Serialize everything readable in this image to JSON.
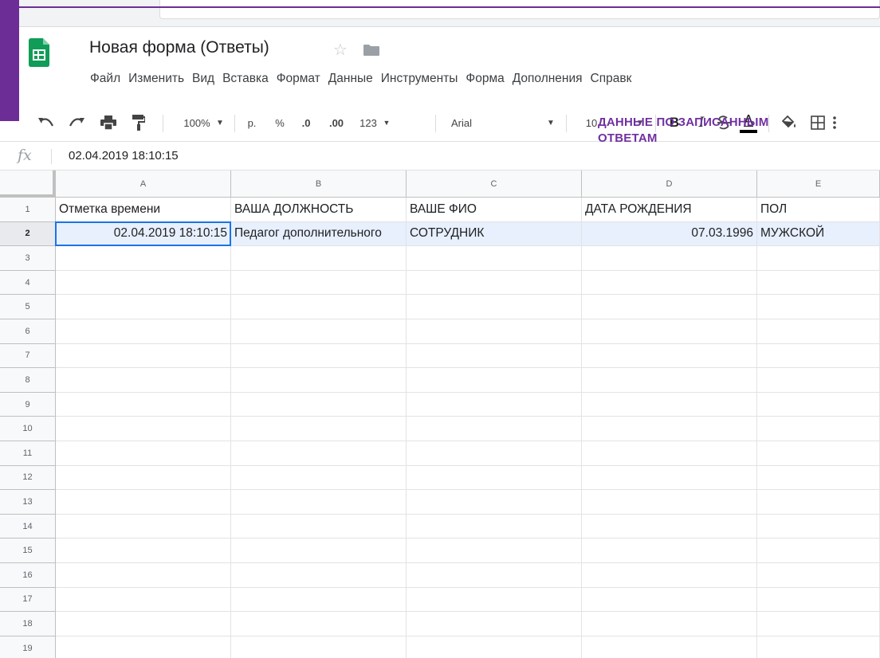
{
  "document": {
    "title": "Новая форма (Ответы)"
  },
  "menu": [
    "Файл",
    "Изменить",
    "Вид",
    "Вставка",
    "Формат",
    "Данные",
    "Инструменты",
    "Форма",
    "Дополнения",
    "Справк"
  ],
  "toolbar": {
    "zoom": "100%",
    "currency": "р.",
    "percent": "%",
    "decimal_decrease": ".0",
    "decimal_increase": ".00",
    "more_formats": "123",
    "font": "Arial",
    "font_size": "10",
    "bold": "B",
    "italic": "I",
    "text_color": "A"
  },
  "formula_bar": {
    "fx": "fx",
    "value": "02.04.2019 18:10:15"
  },
  "columns": [
    "A",
    "B",
    "C",
    "D",
    "E"
  ],
  "row_numbers": [
    "1",
    "2",
    "3",
    "4",
    "5",
    "6",
    "7",
    "8",
    "9",
    "10",
    "11",
    "12",
    "13",
    "14",
    "15",
    "16",
    "17",
    "18",
    "19"
  ],
  "rows": [
    [
      "Отметка времени",
      "ВАША ДОЛЖНОСТЬ",
      "ВАШЕ ФИО",
      "ДАТА РОЖДЕНИЯ",
      "ПОЛ"
    ],
    [
      "02.04.2019 18:10:15",
      "Педагог дополнительного",
      "СОТРУДНИК",
      "07.03.1996",
      "МУЖСКОЙ"
    ]
  ],
  "annotation": {
    "line1": "ДАННЫЕ ПО ЗАПИСАННЫМ",
    "line2": "ОТВЕТАМ"
  },
  "colors": {
    "accent_purple": "#7030a0",
    "frame_purple": "#6d2d96",
    "sheets_green": "#0f9d58",
    "selection_blue": "#1a73e8"
  }
}
